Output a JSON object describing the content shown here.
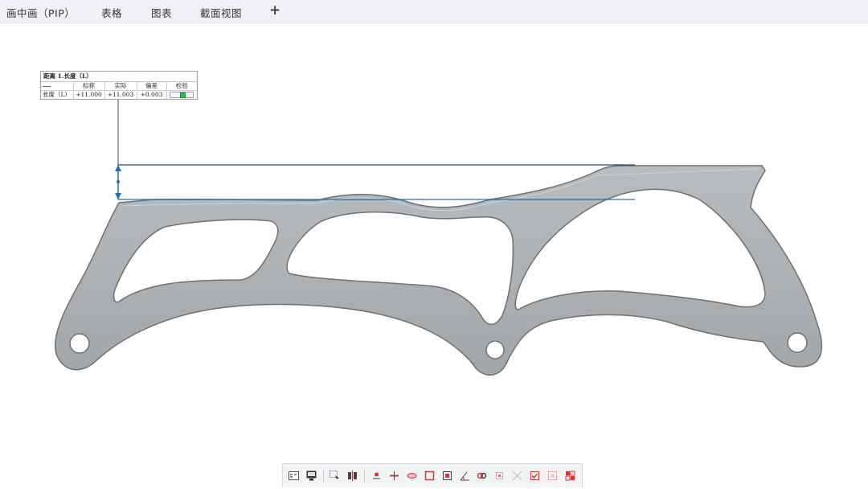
{
  "tabs": [
    {
      "label": "画中画（PIP）"
    },
    {
      "label": "表格"
    },
    {
      "label": "图表"
    },
    {
      "label": "截面视图"
    }
  ],
  "add_tab_label": "+",
  "measurement": {
    "title": "距离 1.长度（L）",
    "headers": [
      "标称",
      "实际",
      "偏差",
      "检验"
    ],
    "row": {
      "label": "长度（L）",
      "nominal": "+11.000",
      "actual": "+11.003",
      "deviation": "+0.003",
      "status": "pass"
    }
  },
  "colors": {
    "part_fill": "#a9acaf",
    "part_edge": "#6c7074",
    "dimension_line": "#1f6fb3",
    "pass": "#2fbf4a",
    "toolbar_icon_red": "#c8383c"
  },
  "toolbar": {
    "buttons": [
      "grid-view-icon",
      "monitor-icon",
      "select-cursor-icon",
      "align-icon",
      "point-icon",
      "line-feature-icon",
      "plane-feature-icon",
      "rectangle-icon",
      "distance-icon",
      "angle-icon",
      "chain-icon",
      "crop-icon",
      "expand-icon",
      "check-icon",
      "delete-icon",
      "report-icon"
    ]
  }
}
